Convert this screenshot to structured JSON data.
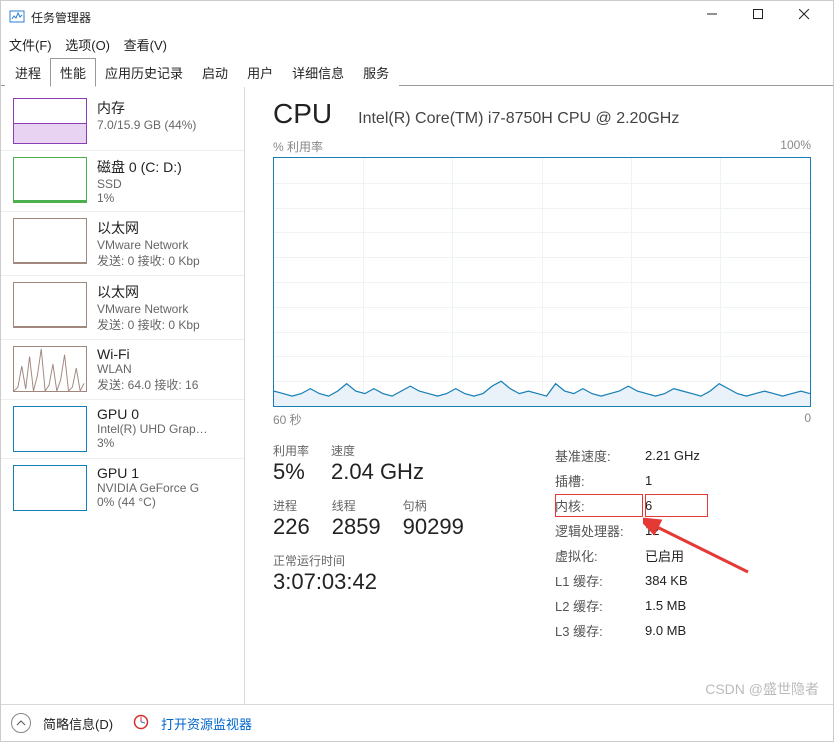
{
  "window": {
    "title": "任务管理器"
  },
  "menu": {
    "file": "文件(F)",
    "options": "选项(O)",
    "view": "查看(V)"
  },
  "tabs": [
    "进程",
    "性能",
    "应用历史记录",
    "启动",
    "用户",
    "详细信息",
    "服务"
  ],
  "active_tab": 1,
  "sidebar": [
    {
      "title": "内存",
      "line1": "7.0/15.9 GB (44%)",
      "type": "mem"
    },
    {
      "title": "磁盘 0 (C: D:)",
      "line1": "SSD",
      "line2": "1%",
      "type": "disk"
    },
    {
      "title": "以太网",
      "line1": "VMware Network ",
      "line2": "发送: 0 接收: 0 Kbp",
      "type": "eth"
    },
    {
      "title": "以太网",
      "line1": "VMware Network ",
      "line2": "发送: 0 接收: 0 Kbp",
      "type": "eth"
    },
    {
      "title": "Wi-Fi",
      "line1": "WLAN",
      "line2": "发送: 64.0 接收: 16",
      "type": "wifi"
    },
    {
      "title": "GPU 0",
      "line1": "Intel(R) UHD Grap…",
      "line2": "3%",
      "type": "gpu"
    },
    {
      "title": "GPU 1",
      "line1": "NVIDIA GeForce G",
      "line2": "0% (44 °C)",
      "type": "gpu"
    }
  ],
  "main": {
    "heading": "CPU",
    "model": "Intel(R) Core(TM) i7-8750H CPU @ 2.20GHz",
    "chart_top_left": "% 利用率",
    "chart_top_right": "100%",
    "chart_bottom_left": "60 秒",
    "chart_bottom_right": "0",
    "stats_left": [
      {
        "label": "利用率",
        "value": "5%"
      },
      {
        "label": "速度",
        "value": "2.04 GHz"
      },
      {
        "label": "进程",
        "value": "226"
      },
      {
        "label": "线程",
        "value": "2859"
      },
      {
        "label": "句柄",
        "value": "90299"
      }
    ],
    "uptime_label": "正常运行时间",
    "uptime_value": "3:07:03:42",
    "stats_right": [
      {
        "label": "基准速度:",
        "value": "2.21 GHz"
      },
      {
        "label": "插槽:",
        "value": "1"
      },
      {
        "label": "内核:",
        "value": "6",
        "highlighted": true
      },
      {
        "label": "逻辑处理器:",
        "value": "12"
      },
      {
        "label": "虚拟化:",
        "value": "已启用"
      },
      {
        "label": "L1 缓存:",
        "value": "384 KB"
      },
      {
        "label": "L2 缓存:",
        "value": "1.5 MB"
      },
      {
        "label": "L3 缓存:",
        "value": "9.0 MB"
      }
    ]
  },
  "footer": {
    "brief": "简略信息(D)",
    "resmon": "打开资源监视器"
  },
  "watermark": "CSDN @盛世隐者",
  "chart_data": {
    "type": "line",
    "title": "% 利用率",
    "xlabel": "60 秒",
    "ylabel": "% 利用率",
    "ylim": [
      0,
      100
    ],
    "xrange_seconds": [
      60,
      0
    ],
    "values": [
      6,
      5,
      4,
      5,
      7,
      5,
      4,
      6,
      9,
      6,
      5,
      7,
      5,
      4,
      6,
      8,
      6,
      5,
      4,
      5,
      7,
      5,
      4,
      5,
      8,
      10,
      7,
      5,
      6,
      5,
      4,
      9,
      6,
      5,
      7,
      5,
      4,
      5,
      6,
      8,
      6,
      5,
      4,
      5,
      7,
      6,
      5,
      4,
      6,
      9,
      7,
      5,
      4,
      5,
      6,
      5,
      4,
      5,
      6,
      5
    ]
  }
}
